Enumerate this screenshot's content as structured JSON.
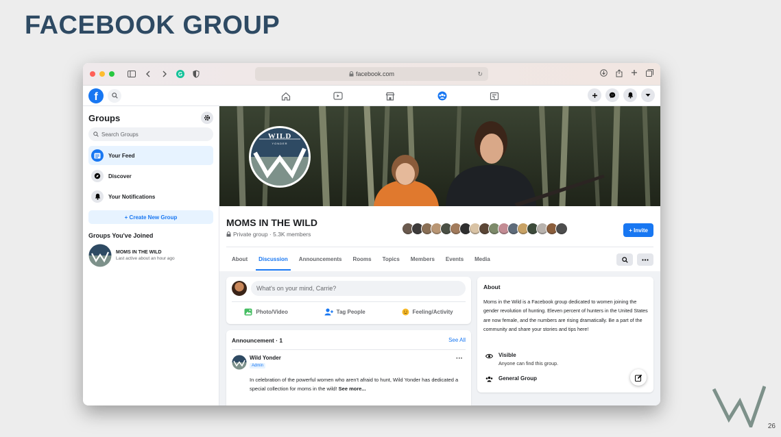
{
  "slide": {
    "title": "FACEBOOK GROUP",
    "page_number": "26"
  },
  "browser": {
    "url": "facebook.com"
  },
  "fb_nav": {
    "nav_icons": [
      "home-icon",
      "watch-icon",
      "marketplace-icon",
      "groups-icon",
      "gaming-icon"
    ],
    "active_nav": "groups-icon",
    "right_buttons": [
      "plus-icon",
      "messenger-icon",
      "bell-icon",
      "caret-down-icon"
    ]
  },
  "sidebar": {
    "title": "Groups",
    "search_placeholder": "Search Groups",
    "items": [
      {
        "label": "Your Feed",
        "icon": "feed-icon",
        "active": true
      },
      {
        "label": "Discover",
        "icon": "compass-icon"
      },
      {
        "label": "Your Notifications",
        "icon": "bell-icon"
      }
    ],
    "create_label": "+ Create New Group",
    "joined_title": "Groups You've Joined",
    "joined": [
      {
        "name": "MOMS IN THE WILD",
        "sub": "Last active about an hour ago"
      }
    ]
  },
  "group": {
    "logo_text": "WILD",
    "logo_subtext": "YONDER",
    "name": "MOMS IN THE WILD",
    "meta": "Private group · 5.3K members",
    "invite_label": "+ Invite",
    "member_colors": [
      "#6b5a4e",
      "#3d3a3a",
      "#8a6f55",
      "#b99674",
      "#4a4f44",
      "#a27b5c",
      "#2f2f2f",
      "#d9c3a5",
      "#5b4636",
      "#7d8a6a",
      "#c38c94",
      "#5e6b7a",
      "#c8a265",
      "#3c4a3a",
      "#b8b2ad",
      "#8a5d3b",
      "#4d4d4d"
    ],
    "tabs": [
      "About",
      "Discussion",
      "Announcements",
      "Rooms",
      "Topics",
      "Members",
      "Events",
      "Media"
    ],
    "active_tab": "Discussion"
  },
  "composer": {
    "placeholder": "What's on your mind, Carrie?",
    "actions": [
      {
        "label": "Photo/Video",
        "icon": "photo-icon",
        "color": "#45bd62"
      },
      {
        "label": "Tag People",
        "icon": "tag-people-icon",
        "color": "#1877f2"
      },
      {
        "label": "Feeling/Activity",
        "icon": "smiley-icon",
        "color": "#f7b928"
      }
    ]
  },
  "announcement": {
    "header": "Announcement · 1",
    "see_all": "See All",
    "author": "Wild Yonder",
    "badge": "Admin",
    "text": "In celebration of the powerful women who aren't afraid to hunt, Wild Yonder has dedicated a special collection for moms in the wild!",
    "see_more": "See more..."
  },
  "about": {
    "title": "About",
    "text": "Moms in the Wild is a Facebook group dedicated to women joining the gender revolution of hunting. Eleven percent of hunters in the United States are now female, and the numbers are rising dramatically. Be a part of the community and share your stories and tips here!",
    "visible_title": "Visible",
    "visible_sub": "Anyone can find this group.",
    "general_title": "General Group"
  },
  "colors": {
    "fb_blue": "#1877f2",
    "slide_title": "#2e4a63",
    "logo_green": "#7d918a"
  }
}
